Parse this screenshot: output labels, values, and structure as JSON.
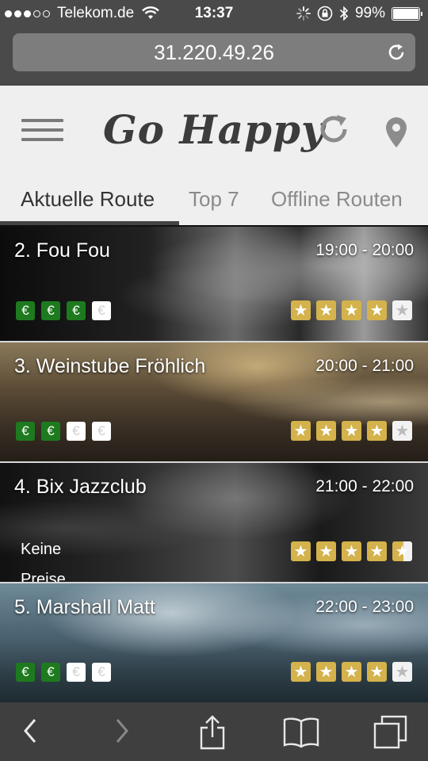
{
  "status_bar": {
    "carrier": "Telekom.de",
    "time": "13:37",
    "battery": "99%",
    "battery_level": 0.99,
    "signal_bars": 3,
    "icons": [
      "wifi-icon",
      "activity-spinner-icon",
      "orientation-lock-icon",
      "bluetooth-icon",
      "battery-icon"
    ]
  },
  "browser": {
    "url": "31.220.49.26",
    "reload_icon": "reload-icon"
  },
  "header": {
    "app_title": "Go Happy",
    "menu_icon": "hamburger-menu-icon",
    "refresh_icon": "refresh-icon",
    "location_icon": "location-pin-icon"
  },
  "tabs": [
    {
      "label": "Aktuelle Route",
      "active": true
    },
    {
      "label": "Top 7",
      "active": false
    },
    {
      "label": "Offline Routen",
      "active": false
    }
  ],
  "routes": [
    {
      "name": "2. Fou Fou",
      "time": "19:00 - 20:00",
      "price_level": 3,
      "price_max": 4,
      "rating": 4,
      "rating_max": 5
    },
    {
      "name": "3. Weinstube Fröhlich",
      "time": "20:00 - 21:00",
      "price_level": 2,
      "price_max": 4,
      "rating": 4,
      "rating_max": 5
    },
    {
      "name": "4. Bix Jazzclub",
      "time": "21:00 - 22:00",
      "price_text": "Keine",
      "price_text_2": "Preise",
      "rating": 4.5,
      "rating_max": 5
    },
    {
      "name": "5. Marshall Matt",
      "time": "22:00 - 23:00",
      "price_level": 2,
      "price_max": 4,
      "rating": 4,
      "rating_max": 5
    }
  ],
  "symbols": {
    "euro": "€",
    "star": "★"
  },
  "colors": {
    "euro_active": "#1e7a1e",
    "star_active": "#d4b24c",
    "header_bg": "#efefef",
    "toolbar_bg": "#3f3f3f"
  },
  "toolbar": {
    "icons": [
      "back-icon",
      "forward-icon",
      "share-icon",
      "bookmarks-icon",
      "tabs-icon"
    ]
  }
}
